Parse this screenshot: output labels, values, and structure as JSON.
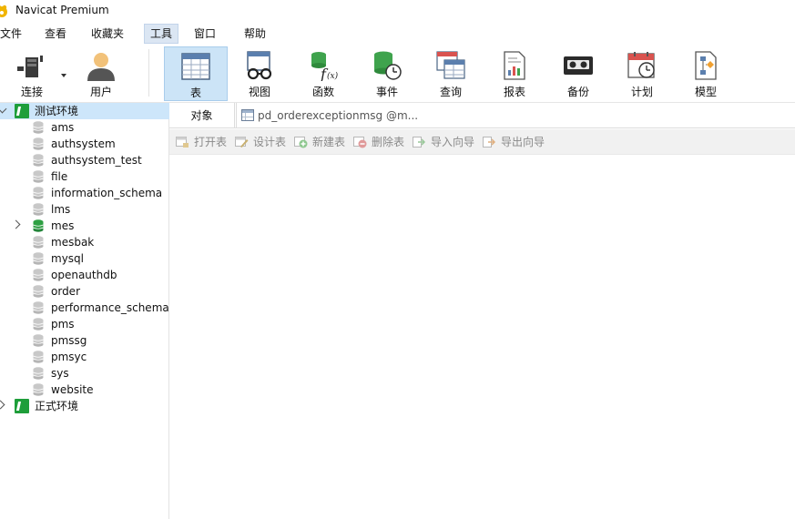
{
  "window": {
    "title": "Navicat Premium"
  },
  "menu": [
    "文件",
    "查看",
    "收藏夹",
    "工具",
    "窗口",
    "帮助"
  ],
  "toolbar": {
    "connect": "连接",
    "user": "用户",
    "table": "表",
    "view": "视图",
    "function": "函数",
    "event": "事件",
    "query": "查询",
    "report": "报表",
    "backup": "备份",
    "schedule": "计划",
    "model": "模型"
  },
  "tree": {
    "connection1": "测试环境",
    "databases": [
      "ams",
      "authsystem",
      "authsystem_test",
      "file",
      "information_schema",
      "lms",
      "mes",
      "mesbak",
      "mysql",
      "openauthdb",
      "order",
      "performance_schema",
      "pms",
      "pmssg",
      "pmsyc",
      "sys",
      "website"
    ],
    "connection2": "正式环境"
  },
  "tabs": {
    "objects": "对象",
    "table_tab": "pd_orderexceptionmsg @m..."
  },
  "object_toolbar": {
    "open": "打开表",
    "design": "设计表",
    "new": "新建表",
    "delete": "删除表",
    "import": "导入向导",
    "export": "导出向导"
  },
  "colors": {
    "selection": "#cde6fa",
    "active_tool": "#cce4f7",
    "connection_green": "#1e9e3a",
    "db_active_green": "#2ea043"
  }
}
